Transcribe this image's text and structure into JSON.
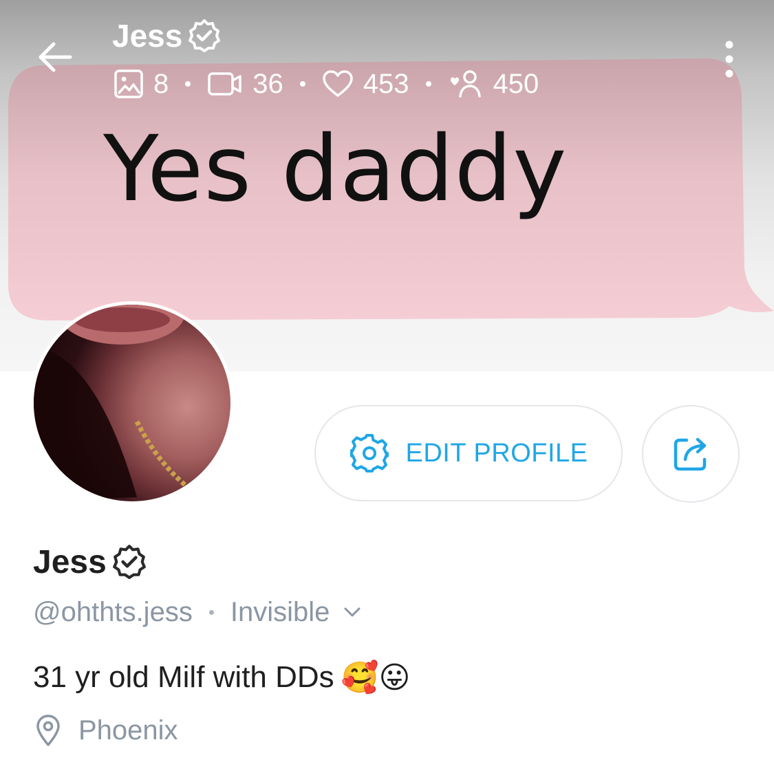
{
  "header": {
    "title": "Jess",
    "stats": {
      "photos": "8",
      "videos": "36",
      "likes": "453",
      "fans": "450"
    }
  },
  "cover": {
    "text": "Yes daddy"
  },
  "actions": {
    "edit_profile_label": "EDIT PROFILE"
  },
  "profile": {
    "name": "Jess",
    "handle": "@ohthts.jess",
    "status": "Invisible",
    "bio": "31 yr old Milf with DDs",
    "bio_emojis": "🥰😛",
    "location": "Phoenix"
  },
  "colors": {
    "accent": "#1fa6e7",
    "muted_text": "#8a96a3",
    "bubble_pink": "#f2c9d0"
  },
  "icons": [
    "back-arrow-icon",
    "verified-badge-icon",
    "image-icon",
    "video-icon",
    "heart-icon",
    "fans-icon",
    "more-vertical-icon",
    "gear-icon",
    "share-icon",
    "chevron-down-icon",
    "location-pin-icon"
  ]
}
